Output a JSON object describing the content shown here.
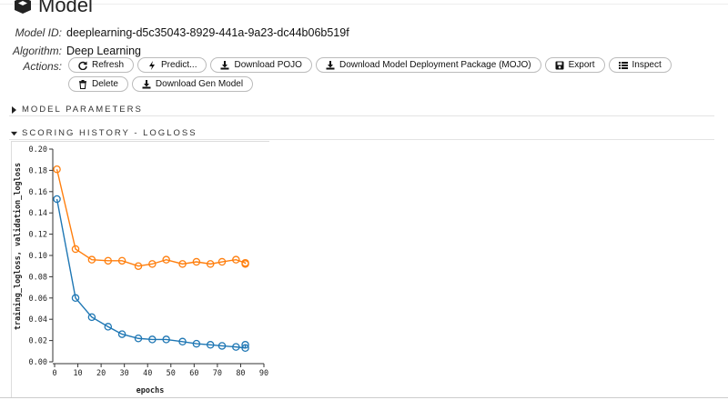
{
  "model": {
    "title": "Model",
    "id_label": "Model ID:",
    "id_value": "deeplearning-d5c35043-8929-441a-9a23-dc44b06b519f",
    "algorithm_label": "Algorithm:",
    "algorithm_value": "Deep Learning",
    "actions_label": "Actions:"
  },
  "actions": [
    {
      "label": "Refresh",
      "icon": "refresh-icon"
    },
    {
      "label": "Predict...",
      "icon": "bolt-icon"
    },
    {
      "label": "Download POJO",
      "icon": "download-icon"
    },
    {
      "label": "Download Model Deployment Package (MOJO)",
      "icon": "download-icon"
    },
    {
      "label": "Export",
      "icon": "save-icon"
    },
    {
      "label": "Inspect",
      "icon": "list-icon"
    },
    {
      "label": "Delete",
      "icon": "trash-icon"
    },
    {
      "label": "Download Gen Model",
      "icon": "download-icon"
    }
  ],
  "sections": {
    "model_parameters": "MODEL PARAMETERS",
    "scoring_history": "SCORING HISTORY - LOGLOSS"
  },
  "chart_data": {
    "type": "scatter",
    "xlabel": "epochs",
    "ylabel": "training_logloss, validation_logloss",
    "xlim": [
      0,
      90
    ],
    "ylim": [
      0,
      0.2
    ],
    "x_ticks": [
      0,
      10,
      20,
      30,
      40,
      50,
      60,
      70,
      80,
      90
    ],
    "y_ticks": [
      0.0,
      0.02,
      0.04,
      0.06,
      0.08,
      0.1,
      0.12,
      0.14,
      0.16,
      0.18,
      0.2
    ],
    "series": [
      {
        "color": "#1f77b4",
        "x": [
          1,
          9,
          16,
          23,
          29,
          36,
          42,
          48,
          55,
          61,
          67,
          72,
          78,
          82,
          82
        ],
        "y": [
          0.153,
          0.06,
          0.042,
          0.033,
          0.026,
          0.022,
          0.021,
          0.021,
          0.019,
          0.017,
          0.016,
          0.015,
          0.014,
          0.013,
          0.016
        ]
      },
      {
        "color": "#ff7f0e",
        "x": [
          1,
          9,
          16,
          23,
          29,
          36,
          42,
          48,
          55,
          61,
          67,
          72,
          78,
          82,
          82
        ],
        "y": [
          0.181,
          0.106,
          0.096,
          0.095,
          0.095,
          0.09,
          0.092,
          0.096,
          0.092,
          0.094,
          0.092,
          0.094,
          0.096,
          0.093,
          0.092
        ]
      }
    ]
  }
}
